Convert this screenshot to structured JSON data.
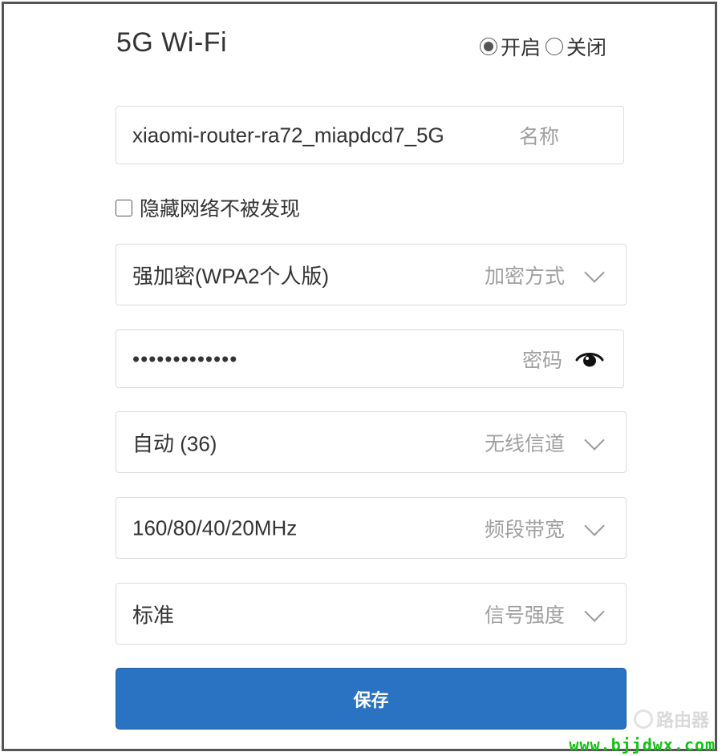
{
  "header": {
    "title": "5G Wi-Fi",
    "radio_on_label": "开启",
    "radio_off_label": "关闭"
  },
  "ssid": {
    "value": "xiaomi-router-ra72_miapdcd7_5G",
    "hint": "名称"
  },
  "hidden_network": {
    "label": "隐藏网络不被发现",
    "checked": false
  },
  "encryption": {
    "value": "强加密(WPA2个人版)",
    "hint": "加密方式"
  },
  "password": {
    "value": "•••••••••••••",
    "hint": "密码",
    "icon": "eye-icon"
  },
  "channel": {
    "value": "自动 (36)",
    "hint": "无线信道"
  },
  "bandwidth": {
    "value": "160/80/40/20MHz",
    "hint": "频段带宽"
  },
  "signal": {
    "value": "标准",
    "hint": "信号强度"
  },
  "save_label": "保存",
  "watermark": {
    "logo_text": "路由器",
    "url": "www.bjjdwx.com"
  },
  "colors": {
    "primary_button": "#2a72c2",
    "watermark": "#12c212",
    "hint_text": "#a0a0a0"
  }
}
